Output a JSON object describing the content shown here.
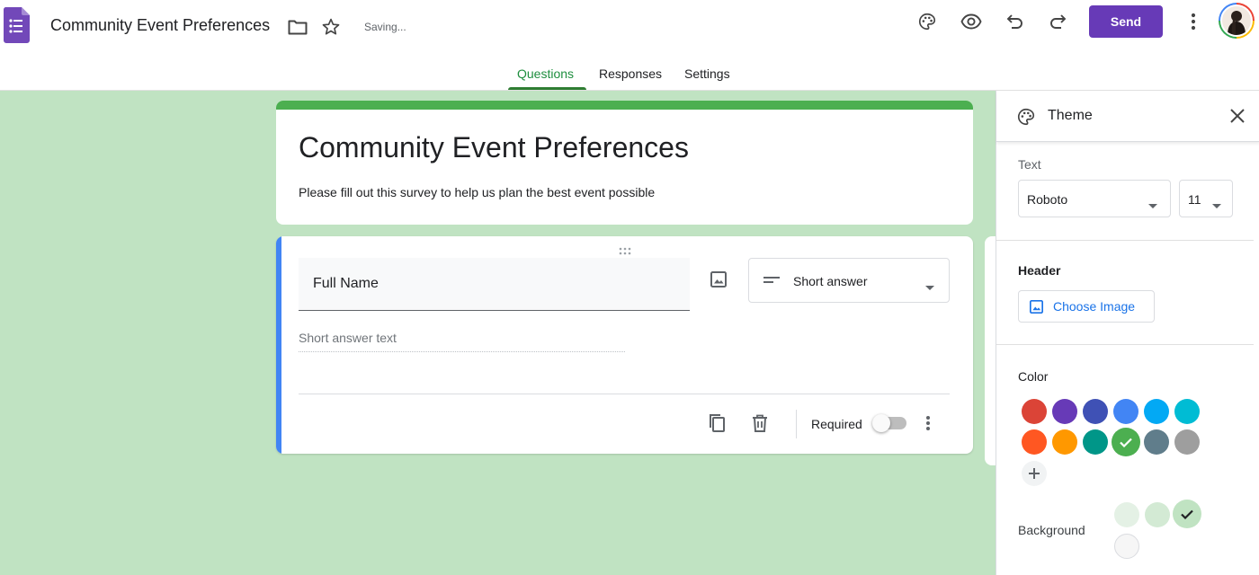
{
  "header": {
    "doc_title": "Community Event Preferences",
    "saving_status": "Saving...",
    "send_label": "Send"
  },
  "tabs": [
    {
      "label": "Questions",
      "active": true
    },
    {
      "label": "Responses",
      "active": false
    },
    {
      "label": "Settings",
      "active": false
    }
  ],
  "form": {
    "title": "Community Event Preferences",
    "description": "Please fill out this survey to help us plan the best event possible"
  },
  "question": {
    "text": "Full Name",
    "type": "Short answer",
    "answer_placeholder": "Short answer text",
    "required_label": "Required",
    "required": false
  },
  "theme_panel": {
    "title": "Theme",
    "text_label": "Text",
    "font": "Roboto",
    "font_size": "11",
    "header_label": "Header",
    "choose_image_label": "Choose Image",
    "color_label": "Color",
    "background_label": "Background",
    "colors": [
      "#db4437",
      "#673ab7",
      "#3f51b5",
      "#4285f4",
      "#03a9f4",
      "#00bcd4",
      "#ff5722",
      "#ff9800",
      "#009688",
      "#4caf50",
      "#607d8b",
      "#9e9e9e"
    ],
    "selected_color": "#4caf50",
    "backgrounds": [
      "#e4f1e5",
      "#d3ead4",
      "#c0e3c2",
      "#f6f6f6"
    ],
    "selected_background": "#c0e3c2"
  },
  "icons": [
    "forms-logo-icon",
    "folder-icon",
    "star-icon",
    "palette-icon",
    "preview-eye-icon",
    "undo-icon",
    "redo-icon",
    "more-vert-icon",
    "image-icon",
    "short-answer-icon",
    "duplicate-icon",
    "delete-icon",
    "close-icon",
    "add-icon",
    "check-icon"
  ]
}
